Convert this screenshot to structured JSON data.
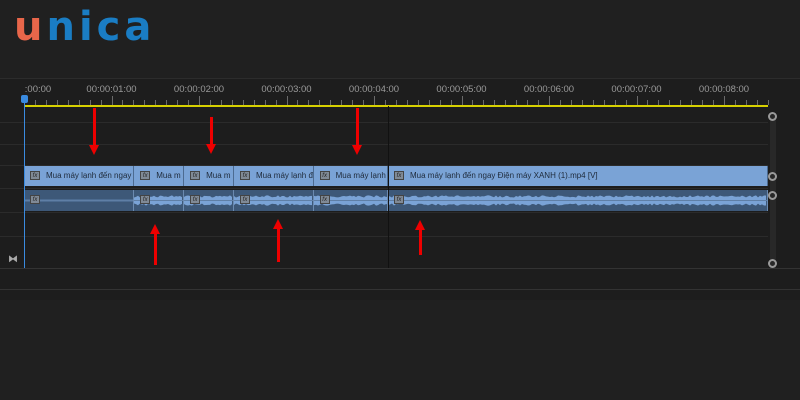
{
  "logo": {
    "text": "unica",
    "first": "u",
    "rest": "nica",
    "colors": {
      "u": "#e8664a",
      "rest": "#1a7dc4"
    }
  },
  "ruler": {
    "labels": [
      ":00:00",
      "00:00:01:00",
      "00:00:02:00",
      "00:00:03:00",
      "00:00:04:00",
      "00:00:05:00",
      "00:00:06:00",
      "00:00:07:00",
      "00:00:08:00"
    ]
  },
  "video_clips": [
    {
      "label": "Mua máy lạnh đến ngay",
      "start": 0,
      "end": 1.26
    },
    {
      "label": "Mua m",
      "start": 1.26,
      "end": 1.83
    },
    {
      "label": "Mua m",
      "start": 1.83,
      "end": 2.4
    },
    {
      "label": "Mua máy lạnh đ",
      "start": 2.4,
      "end": 3.31
    },
    {
      "label": "Mua máy lạnh",
      "start": 3.31,
      "end": 4.16
    },
    {
      "label": "Mua máy lạnh đến ngay Điện máy XANH (1).mp4 [V]",
      "start": 4.16,
      "end": 8.5
    }
  ],
  "fx_label": "fx",
  "colors": {
    "video": "#7aa3d6",
    "audio": "#3d5878",
    "playhead": "#3a8be0",
    "work_area": "#d7d000",
    "annotation": "#e00000"
  },
  "annotations": {
    "down_arrows_at_seconds": [
      0.8,
      2.14,
      3.8
    ],
    "up_arrows_at_seconds": [
      1.5,
      2.9,
      4.52
    ]
  }
}
